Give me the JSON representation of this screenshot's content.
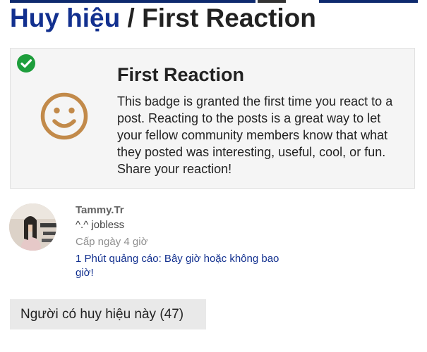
{
  "header": {
    "breadcrumb_label": "Huy hiệu",
    "separator": "/",
    "badge_name": "First Reaction"
  },
  "badge": {
    "name": "First Reaction",
    "description": "This badge is granted the first time you react to a post. Reacting to the posts is a great way to let your fellow community members know that what they posted was interesting, useful, cool, or fun. Share your reaction!",
    "badge_icon": "smiley-face-icon",
    "granted_icon": "check-circle-icon",
    "colors": {
      "icon": "#c28a4a",
      "granted": "#1e9e3c",
      "link": "#12308f"
    }
  },
  "grant": {
    "username": "Tammy.Tr",
    "user_title": "^.^ jobless",
    "granted_time": "Cấp ngày 4 giờ",
    "topic_title": "1 Phút quảng cáo: Bây giờ hoặc không bao giờ!"
  },
  "holders": {
    "button_label": "Người có huy hiệu này (47)"
  }
}
